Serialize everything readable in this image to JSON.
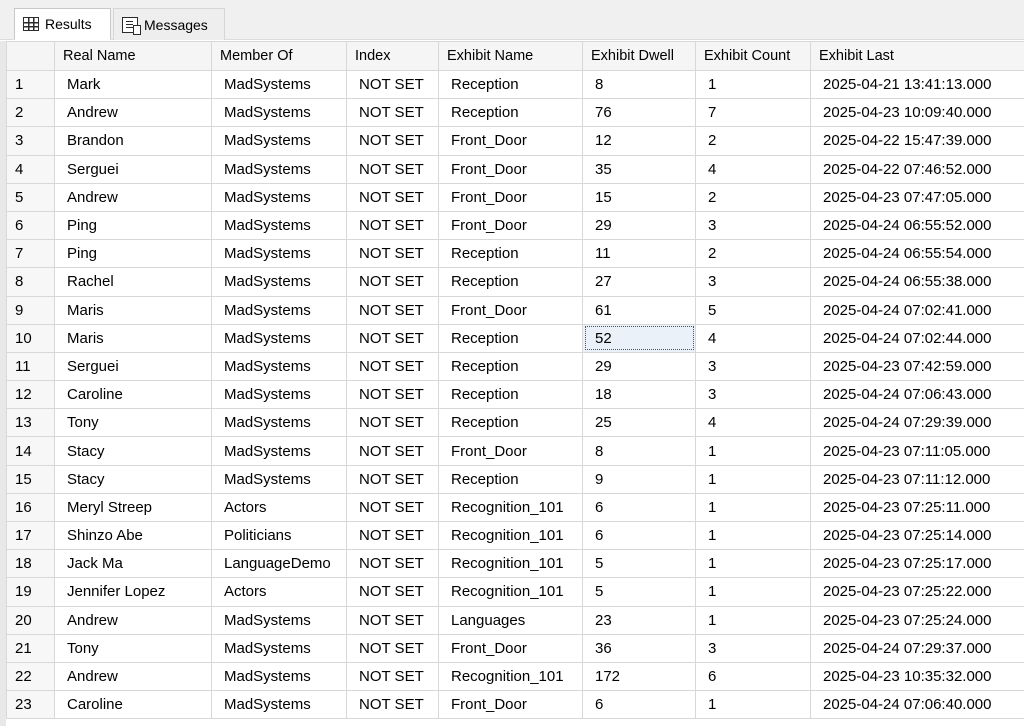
{
  "tabs": [
    {
      "label": "Results",
      "icon": "grid-icon",
      "active": true
    },
    {
      "label": "Messages",
      "icon": "messages-icon",
      "active": false
    }
  ],
  "columns": [
    "",
    "Real Name",
    "Member Of",
    "Index",
    "Exhibit Name",
    "Exhibit Dwell",
    "Exhibit Count",
    "Exhibit Last"
  ],
  "rows": [
    [
      "1",
      "Mark",
      "MadSystems",
      "NOT SET",
      "Reception",
      "8",
      "1",
      "2025-04-21 13:41:13.000"
    ],
    [
      "2",
      "Andrew",
      "MadSystems",
      "NOT SET",
      "Reception",
      "76",
      "7",
      "2025-04-23 10:09:40.000"
    ],
    [
      "3",
      "Brandon",
      "MadSystems",
      "NOT SET",
      "Front_Door",
      "12",
      "2",
      "2025-04-22 15:47:39.000"
    ],
    [
      "4",
      "Serguei",
      "MadSystems",
      "NOT SET",
      "Front_Door",
      "35",
      "4",
      "2025-04-22 07:46:52.000"
    ],
    [
      "5",
      "Andrew",
      "MadSystems",
      "NOT SET",
      "Front_Door",
      "15",
      "2",
      "2025-04-23 07:47:05.000"
    ],
    [
      "6",
      "Ping",
      "MadSystems",
      "NOT SET",
      "Front_Door",
      "29",
      "3",
      "2025-04-24 06:55:52.000"
    ],
    [
      "7",
      "Ping",
      "MadSystems",
      "NOT SET",
      "Reception",
      "11",
      "2",
      "2025-04-24 06:55:54.000"
    ],
    [
      "8",
      "Rachel",
      "MadSystems",
      "NOT SET",
      "Reception",
      "27",
      "3",
      "2025-04-24 06:55:38.000"
    ],
    [
      "9",
      "Maris",
      "MadSystems",
      "NOT SET",
      "Front_Door",
      "61",
      "5",
      "2025-04-24 07:02:41.000"
    ],
    [
      "10",
      "Maris",
      "MadSystems",
      "NOT SET",
      "Reception",
      "52",
      "4",
      "2025-04-24 07:02:44.000"
    ],
    [
      "11",
      "Serguei",
      "MadSystems",
      "NOT SET",
      "Reception",
      "29",
      "3",
      "2025-04-23 07:42:59.000"
    ],
    [
      "12",
      "Caroline",
      "MadSystems",
      "NOT SET",
      "Reception",
      "18",
      "3",
      "2025-04-24 07:06:43.000"
    ],
    [
      "13",
      "Tony",
      "MadSystems",
      "NOT SET",
      "Reception",
      "25",
      "4",
      "2025-04-24 07:29:39.000"
    ],
    [
      "14",
      "Stacy",
      "MadSystems",
      "NOT SET",
      "Front_Door",
      "8",
      "1",
      "2025-04-23 07:11:05.000"
    ],
    [
      "15",
      "Stacy",
      "MadSystems",
      "NOT SET",
      "Reception",
      "9",
      "1",
      "2025-04-23 07:11:12.000"
    ],
    [
      "16",
      "Meryl Streep",
      "Actors",
      "NOT SET",
      "Recognition_101",
      "6",
      "1",
      "2025-04-23 07:25:11.000"
    ],
    [
      "17",
      "Shinzo Abe",
      "Politicians",
      "NOT SET",
      "Recognition_101",
      "6",
      "1",
      "2025-04-23 07:25:14.000"
    ],
    [
      "18",
      "Jack Ma",
      "LanguageDemo",
      "NOT SET",
      "Recognition_101",
      "5",
      "1",
      "2025-04-23 07:25:17.000"
    ],
    [
      "19",
      "Jennifer Lopez",
      "Actors",
      "NOT SET",
      "Recognition_101",
      "5",
      "1",
      "2025-04-23 07:25:22.000"
    ],
    [
      "20",
      "Andrew",
      "MadSystems",
      "NOT SET",
      "Languages",
      "23",
      "1",
      "2025-04-23 07:25:24.000"
    ],
    [
      "21",
      "Tony",
      "MadSystems",
      "NOT SET",
      "Front_Door",
      "36",
      "3",
      "2025-04-24 07:29:37.000"
    ],
    [
      "22",
      "Andrew",
      "MadSystems",
      "NOT SET",
      "Recognition_101",
      "172",
      "6",
      "2025-04-23 10:35:32.000"
    ],
    [
      "23",
      "Caroline",
      "MadSystems",
      "NOT SET",
      "Front_Door",
      "6",
      "1",
      "2025-04-24 07:06:40.000"
    ]
  ],
  "focused_cell": {
    "row": 10,
    "column": "Exhibit Dwell"
  }
}
